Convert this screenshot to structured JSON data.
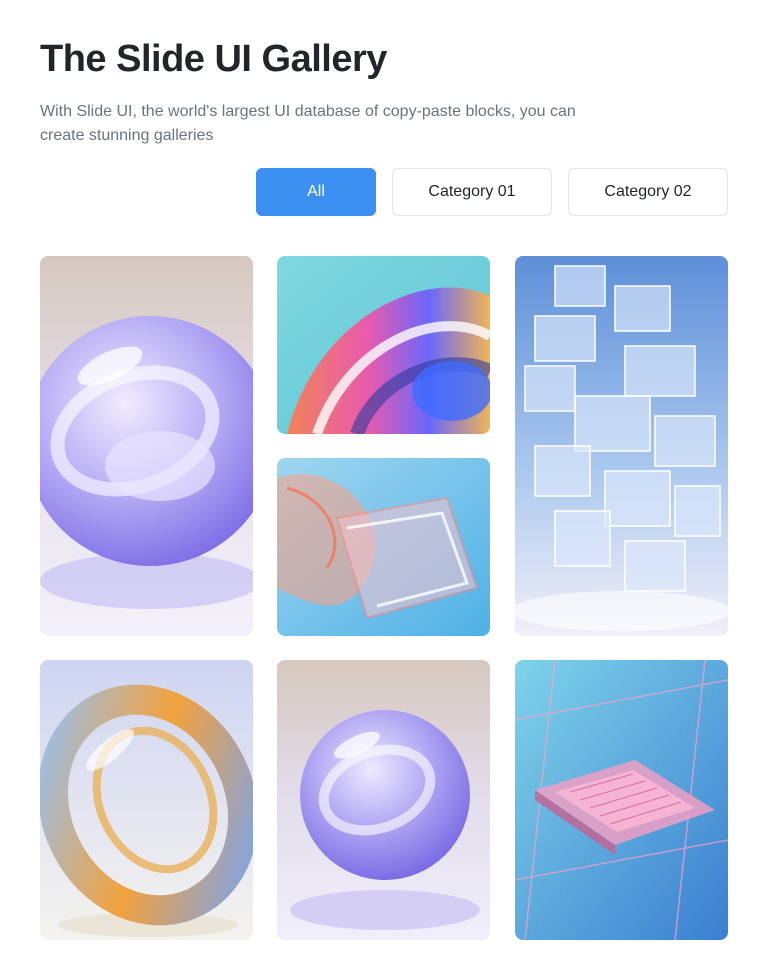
{
  "header": {
    "title": "The Slide UI Gallery",
    "description": "With Slide UI, the world's largest UI database of copy-paste blocks, you can create stunning galleries"
  },
  "filters": [
    {
      "label": "All",
      "active": true
    },
    {
      "label": "Category 01",
      "active": false
    },
    {
      "label": "Category 02",
      "active": false
    }
  ],
  "colors": {
    "accent": "#3b8ff0",
    "title": "#22262b",
    "muted_text": "#6b7280",
    "border": "#e3e5e8"
  },
  "gallery": {
    "images": [
      {
        "name": "glass-sphere-lavender"
      },
      {
        "name": "iridescent-swirl"
      },
      {
        "name": "glass-ribbon-coral"
      },
      {
        "name": "glass-cube-tower"
      },
      {
        "name": "glass-ring-gold"
      },
      {
        "name": "glass-sphere-violet"
      },
      {
        "name": "microchip-circuit"
      }
    ]
  }
}
